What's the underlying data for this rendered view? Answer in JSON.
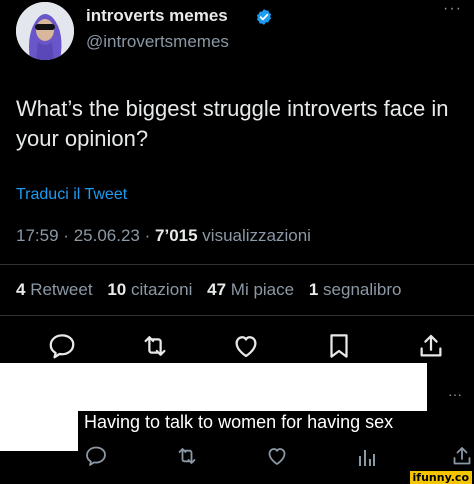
{
  "tweet": {
    "author_name": "introverts memes",
    "author_handle": "@introvertsmemes",
    "more": "···",
    "text": "What’s the biggest struggle introverts face in your opinion?",
    "translate": "Traduci il Tweet",
    "time": "17:59",
    "date": "25.06.23",
    "views_count": "7’015",
    "views_label": "visualizzazioni",
    "separator": "·"
  },
  "stats": {
    "retweets_count": "4",
    "retweets_label": "Retweet",
    "quotes_count": "10",
    "quotes_label": "citazioni",
    "likes_count": "47",
    "likes_label": "Mi piace",
    "bookmarks_count": "1",
    "bookmarks_label": "segnalibro"
  },
  "reply": {
    "text": "Having to talk to women for having sex",
    "more": "···"
  },
  "watermark": "ifunny.co",
  "colors": {
    "background": "#000000",
    "text": "#e7e9ea",
    "secondary": "#8b98a5",
    "link": "#1d9bf0",
    "verified": "#1d9bf0",
    "watermark": "#f4c400"
  },
  "icons": [
    "reply-icon",
    "retweet-icon",
    "like-icon",
    "bookmark-icon",
    "share-icon",
    "views-icon"
  ]
}
